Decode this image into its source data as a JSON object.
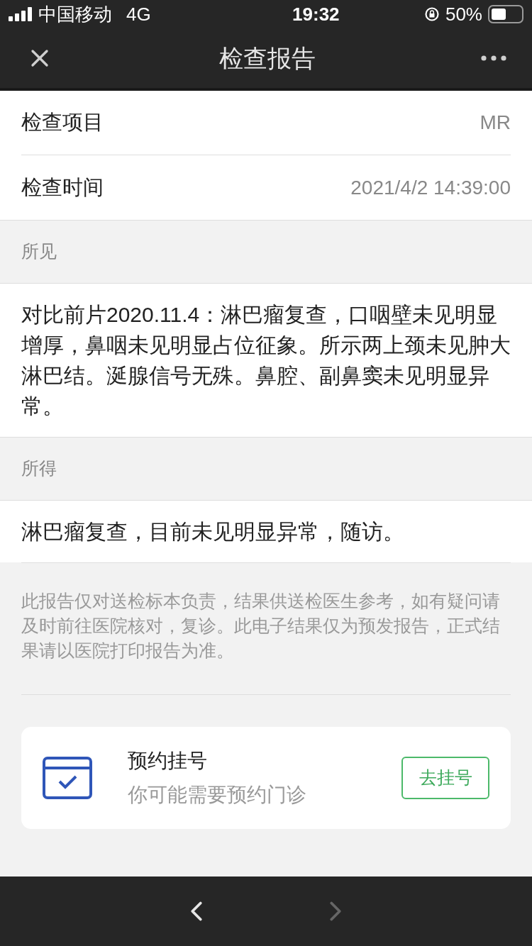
{
  "status_bar": {
    "carrier": "中国移动",
    "network": "4G",
    "time": "19:32",
    "battery": "50%"
  },
  "nav_bar": {
    "title": "检查报告"
  },
  "info_rows": [
    {
      "label": "检查项目",
      "value": "MR"
    },
    {
      "label": "检查时间",
      "value": "2021/4/2 14:39:00"
    }
  ],
  "sections": [
    {
      "heading": "所见",
      "body": "对比前片2020.11.4：淋巴瘤复查，口咽壁未见明显增厚，鼻咽未见明显占位征象。所示两上颈未见肿大淋巴结。涎腺信号无殊。鼻腔、副鼻窦未见明显异常。"
    },
    {
      "heading": "所得",
      "body": "淋巴瘤复查，目前未见明显异常，随访。"
    }
  ],
  "disclaimer": "此报告仅对送检标本负责，结果供送检医生参考，如有疑问请及时前往医院核对，复诊。此电子结果仅为预发报告，正式结果请以医院打印报告为准。",
  "appointment_card": {
    "title": "预约挂号",
    "subtitle": "你可能需要预约门诊",
    "button": "去挂号"
  },
  "bottom_bar": {
    "back_disabled": false,
    "forward_disabled": true
  }
}
